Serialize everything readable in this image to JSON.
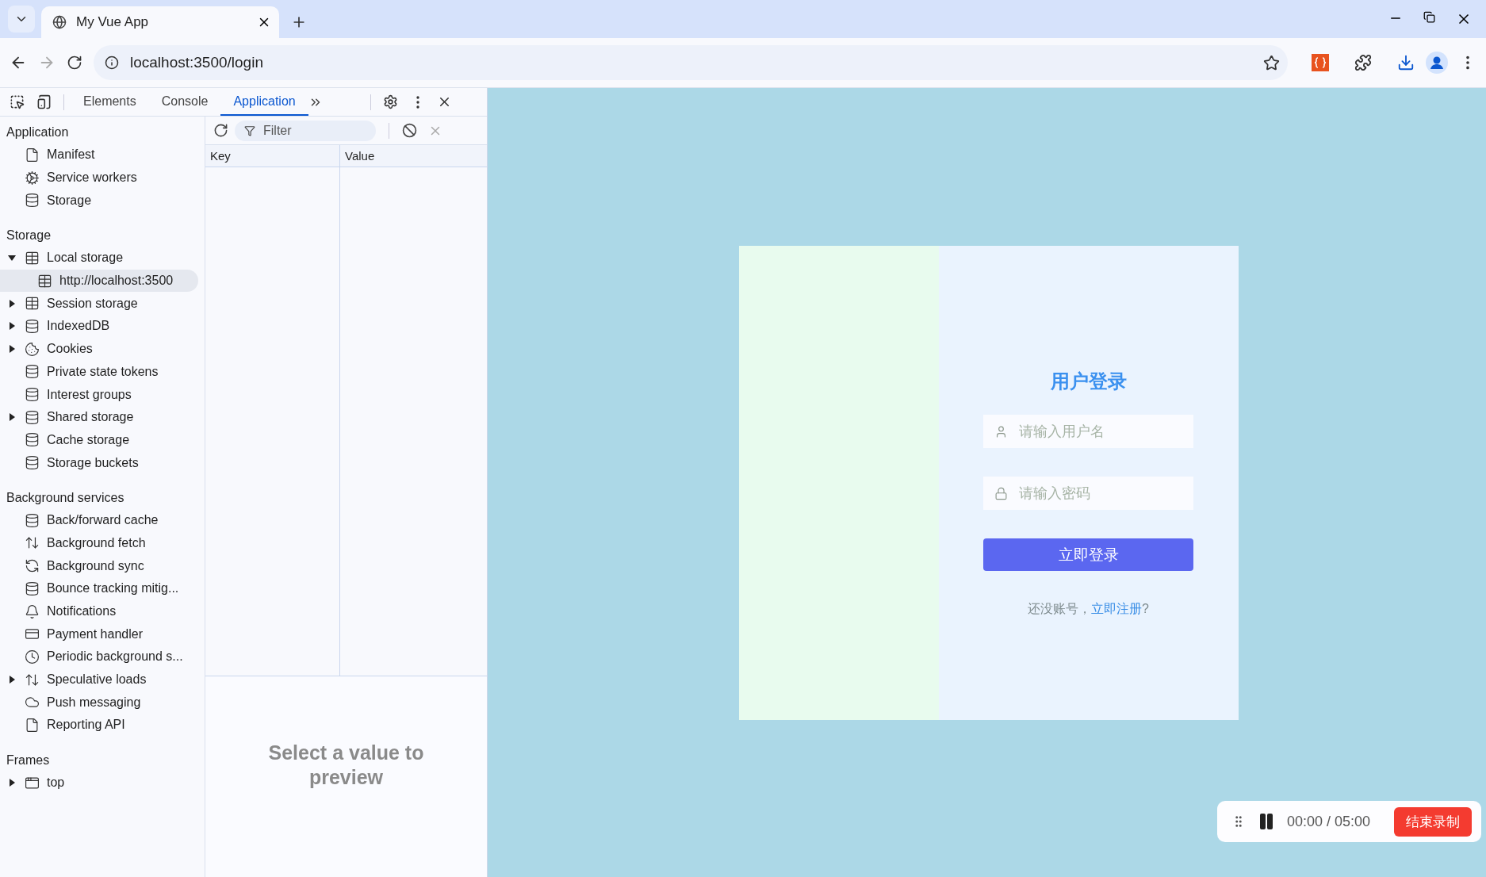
{
  "browser": {
    "tab": {
      "title": "My Vue App",
      "selected": true
    },
    "address": "localhost:3500/login"
  },
  "devtools": {
    "tabs": [
      {
        "label": "Elements",
        "selected": false
      },
      {
        "label": "Console",
        "selected": false
      },
      {
        "label": "Application",
        "selected": true
      }
    ],
    "sidebar": [
      {
        "title": "Application",
        "items": [
          {
            "label": "Manifest",
            "kind": "file",
            "selected": false
          },
          {
            "label": "Service workers",
            "kind": "gears",
            "selected": false
          },
          {
            "label": "Storage",
            "kind": "database",
            "selected": false
          }
        ]
      },
      {
        "title": "Storage",
        "items": [
          {
            "label": "Local storage",
            "kind": "table",
            "selected": false,
            "expanded": true,
            "children": [
              {
                "label": "http://localhost:3500",
                "kind": "table",
                "selected": true
              }
            ]
          },
          {
            "label": "Session storage",
            "kind": "table",
            "selected": false,
            "expanded": false
          },
          {
            "label": "IndexedDB",
            "kind": "database",
            "selected": false,
            "expanded": false
          },
          {
            "label": "Cookies",
            "kind": "cookie",
            "selected": false,
            "expanded": false
          },
          {
            "label": "Private state tokens",
            "kind": "database",
            "selected": false
          },
          {
            "label": "Interest groups",
            "kind": "database",
            "selected": false
          },
          {
            "label": "Shared storage",
            "kind": "database",
            "selected": false,
            "expanded": false
          },
          {
            "label": "Cache storage",
            "kind": "database",
            "selected": false
          },
          {
            "label": "Storage buckets",
            "kind": "database",
            "selected": false
          }
        ]
      },
      {
        "title": "Background services",
        "items": [
          {
            "label": "Back/forward cache",
            "kind": "database",
            "selected": false
          },
          {
            "label": "Background fetch",
            "kind": "updown",
            "selected": false
          },
          {
            "label": "Background sync",
            "kind": "sync",
            "selected": false
          },
          {
            "label": "Bounce tracking mitig...",
            "kind": "database",
            "selected": false
          },
          {
            "label": "Notifications",
            "kind": "bell",
            "selected": false
          },
          {
            "label": "Payment handler",
            "kind": "card",
            "selected": false
          },
          {
            "label": "Periodic background s...",
            "kind": "clock",
            "selected": false
          },
          {
            "label": "Speculative loads",
            "kind": "updown",
            "selected": false,
            "expanded": false
          },
          {
            "label": "Push messaging",
            "kind": "cloud",
            "selected": false
          },
          {
            "label": "Reporting API",
            "kind": "file",
            "selected": false
          }
        ]
      },
      {
        "title": "Frames",
        "items": [
          {
            "label": "top",
            "kind": "frame",
            "selected": false,
            "expanded": false
          }
        ]
      }
    ],
    "filter": {
      "placeholder": "Filter"
    },
    "table": {
      "columns": [
        "Key",
        "Value"
      ]
    },
    "preview_message": "Select a value to preview"
  },
  "login": {
    "title": "用户登录",
    "username": {
      "placeholder": "请输入用户名"
    },
    "password": {
      "placeholder": "请输入密码"
    },
    "submit": "立即登录",
    "register_prompt": "还没账号，",
    "register_link": "立即注册",
    "register_suffix": "?"
  },
  "recorder": {
    "time": "00:00 / 05:00",
    "stop": "结束录制"
  }
}
